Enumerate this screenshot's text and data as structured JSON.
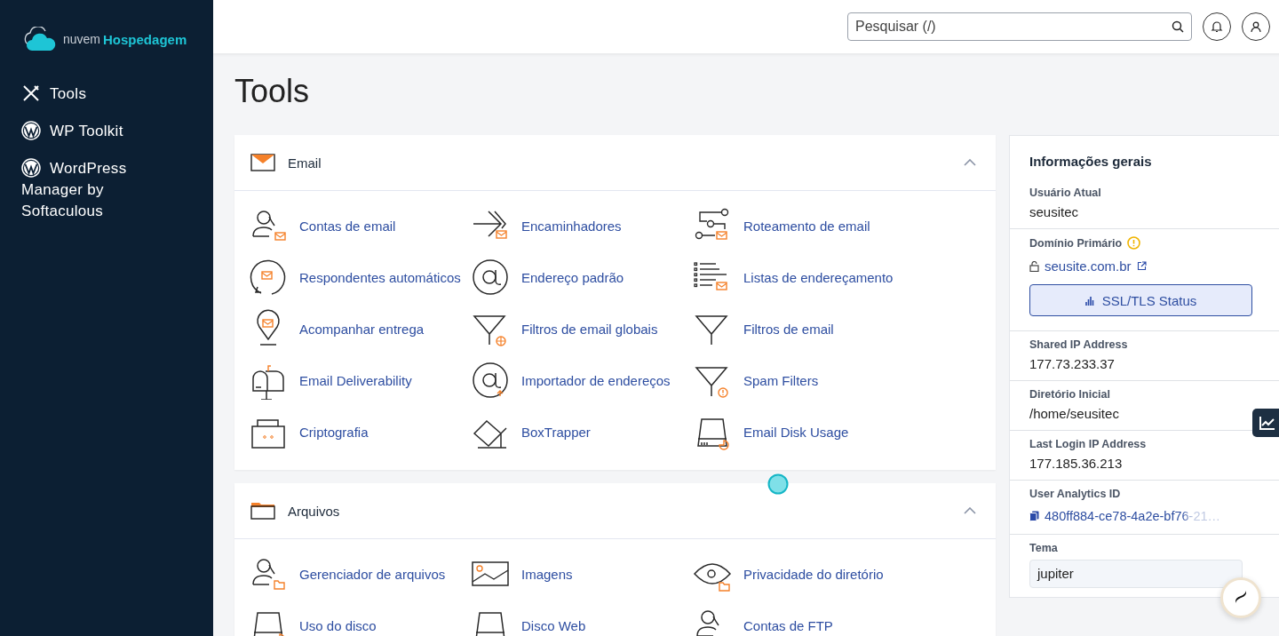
{
  "brand": {
    "light": "nuvem",
    "bold": "Hospedagem"
  },
  "sidebar": {
    "items": [
      {
        "label": "Tools",
        "selected": false
      },
      {
        "label": "WP Toolkit",
        "selected": false
      },
      {
        "label": "WordPress Manager by Softaculous",
        "selected": false
      }
    ]
  },
  "header": {
    "search": {
      "placeholder": "Pesquisar (/)"
    }
  },
  "page_title": "Tools",
  "sections": [
    {
      "title": "Email",
      "expanded": true,
      "items": [
        "Contas de email",
        "Encaminhadores",
        "Roteamento de email",
        "Respondentes automáticos",
        "Endereço padrão",
        "Listas de endereçamento",
        "Acompanhar entrega",
        "Filtros de email globais",
        "Filtros de email",
        "Email Deliverability",
        "Importador de endereços",
        "Spam Filters",
        "Criptografia",
        "BoxTrapper",
        "Email Disk Usage"
      ]
    },
    {
      "title": "Arquivos",
      "expanded": true,
      "items": [
        "Gerenciador de arquivos",
        "Imagens",
        "Privacidade do diretório",
        "Uso do disco",
        "Disco Web",
        "Contas de FTP"
      ]
    }
  ],
  "info": {
    "title": "Informações gerais",
    "current_user": {
      "label": "Usuário Atual",
      "value": "seusitec"
    },
    "primary_domain": {
      "label": "Domínio Primário",
      "warning": true,
      "domain": "seusite.com.br",
      "button": "SSL/TLS Status"
    },
    "rows": [
      {
        "label": "Shared IP Address",
        "value": "177.73.233.37"
      },
      {
        "label": "Diretório Inicial",
        "value": "/home/seusitec"
      },
      {
        "label": "Last Login IP Address",
        "value": "177.185.36.213"
      }
    ],
    "analytics": {
      "label": "User Analytics ID",
      "value": "480ff884-ce78-4a2e-bf76-21…"
    },
    "theme": {
      "label": "Tema",
      "value": "jupiter"
    }
  }
}
